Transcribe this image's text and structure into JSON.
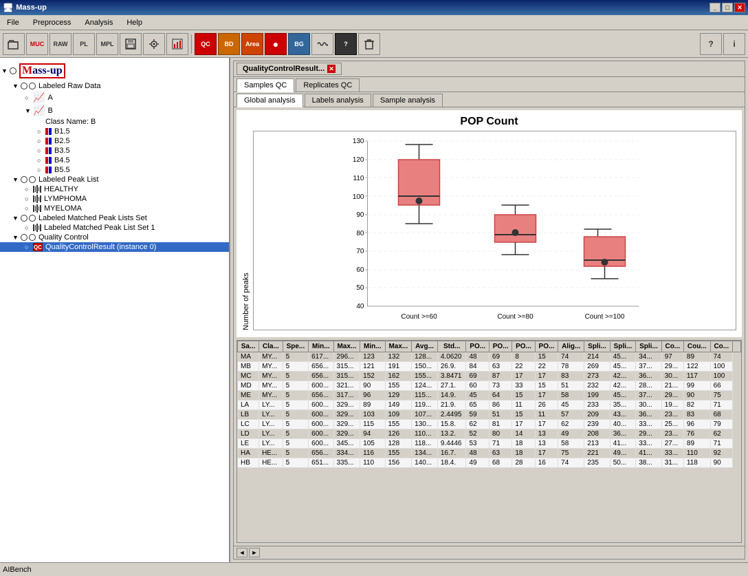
{
  "app": {
    "title": "Mass-up",
    "status_bar": "AIBench"
  },
  "menu": {
    "items": [
      "File",
      "Preprocess",
      "Analysis",
      "Help"
    ]
  },
  "toolbar": {
    "buttons": [
      {
        "name": "open",
        "label": "📂",
        "icon": "open-icon"
      },
      {
        "name": "muc",
        "label": "MUC",
        "icon": "muc-icon"
      },
      {
        "name": "raw",
        "label": "RAW",
        "icon": "raw-icon"
      },
      {
        "name": "pl",
        "label": "PL",
        "icon": "pl-icon"
      },
      {
        "name": "mpl",
        "label": "MPL",
        "icon": "mpl-icon"
      },
      {
        "name": "save",
        "label": "💾",
        "icon": "save-icon"
      },
      {
        "name": "config",
        "label": "⚙",
        "icon": "config-icon"
      },
      {
        "name": "chart",
        "label": "📊",
        "icon": "chart-icon"
      },
      {
        "name": "qc",
        "label": "QC",
        "icon": "qc-icon"
      },
      {
        "name": "bd",
        "label": "BD",
        "icon": "bd-icon"
      },
      {
        "name": "area",
        "label": "Area",
        "icon": "area-icon"
      },
      {
        "name": "red-dot",
        "label": "●",
        "icon": "red-dot-icon"
      },
      {
        "name": "bg",
        "label": "BG",
        "icon": "bg-icon"
      },
      {
        "name": "wave",
        "label": "~",
        "icon": "wave-icon"
      },
      {
        "name": "question2",
        "label": "?",
        "icon": "question2-icon"
      },
      {
        "name": "trash",
        "label": "🗑",
        "icon": "trash-icon"
      }
    ],
    "right_buttons": [
      {
        "name": "help",
        "label": "?",
        "icon": "help-icon"
      },
      {
        "name": "info",
        "label": "i",
        "icon": "info-icon"
      }
    ]
  },
  "tree": {
    "root": "Mass-up",
    "nodes": [
      {
        "id": "labeled-raw-data",
        "label": "Labeled Raw Data",
        "level": 0,
        "type": "folder",
        "expanded": true
      },
      {
        "id": "a",
        "label": "A",
        "level": 1,
        "type": "chart"
      },
      {
        "id": "b",
        "label": "B",
        "level": 1,
        "type": "chart",
        "expanded": true
      },
      {
        "id": "class-b",
        "label": "Class Name: B",
        "level": 2,
        "type": "text"
      },
      {
        "id": "b1.5",
        "label": "B1.5",
        "level": 2,
        "type": "flag"
      },
      {
        "id": "b2.5",
        "label": "B2.5",
        "level": 2,
        "type": "flag"
      },
      {
        "id": "b3.5",
        "label": "B3.5",
        "level": 2,
        "type": "flag"
      },
      {
        "id": "b4.5",
        "label": "B4.5",
        "level": 2,
        "type": "flag"
      },
      {
        "id": "b5.5",
        "label": "B5.5",
        "level": 2,
        "type": "flag"
      },
      {
        "id": "labeled-peak-list",
        "label": "Labeled Peak List",
        "level": 0,
        "type": "folder",
        "expanded": true
      },
      {
        "id": "healthy",
        "label": "HEALTHY",
        "level": 1,
        "type": "barcode"
      },
      {
        "id": "lymphoma",
        "label": "LYMPHOMA",
        "level": 1,
        "type": "barcode"
      },
      {
        "id": "myeloma",
        "label": "MYELOMA",
        "level": 1,
        "type": "barcode"
      },
      {
        "id": "labeled-matched",
        "label": "Labeled Matched Peak Lists Set",
        "level": 0,
        "type": "folder",
        "expanded": true
      },
      {
        "id": "set1",
        "label": "Labeled Matched Peak List Set 1",
        "level": 1,
        "type": "barcode2"
      },
      {
        "id": "quality-control",
        "label": "Quality Control",
        "level": 0,
        "type": "folder",
        "expanded": true
      },
      {
        "id": "qc-result",
        "label": "QualityControlResult (instance 0)",
        "level": 1,
        "type": "qc",
        "selected": true
      }
    ]
  },
  "tab_window": {
    "title": "QualityControlResult...",
    "primary_tabs": [
      "Samples QC",
      "Replicates QC"
    ],
    "active_primary_tab": "Samples QC",
    "secondary_tabs": [
      "Global analysis",
      "Labels analysis",
      "Sample analysis"
    ],
    "active_secondary_tab": "Global analysis"
  },
  "chart": {
    "title": "POP Count",
    "y_axis_label": "Number of peaks",
    "x_labels": [
      "Count >=60",
      "Count >=80",
      "Count >=100"
    ],
    "y_min": 40,
    "y_max": 130,
    "y_ticks": [
      40,
      50,
      60,
      70,
      80,
      90,
      100,
      110,
      120,
      130
    ],
    "box_plots": [
      {
        "label": "Count >=60",
        "x": 100,
        "whisker_low": 85,
        "q1": 95,
        "median": 100,
        "mean": 98,
        "q3": 120,
        "whisker_high": 128,
        "color": "#e88080"
      },
      {
        "label": "Count >=80",
        "x": 240,
        "whisker_low": 68,
        "q1": 75,
        "median": 79,
        "mean": 80,
        "q3": 90,
        "whisker_high": 95,
        "color": "#e88080"
      },
      {
        "label": "Count >=100",
        "x": 370,
        "whisker_low": 55,
        "q1": 62,
        "median": 65,
        "mean": 64,
        "q3": 78,
        "whisker_high": 82,
        "color": "#e88080"
      }
    ]
  },
  "table": {
    "columns": [
      "Sa...",
      "Cla...",
      "Spe...",
      "Min...",
      "Max...",
      "Min...",
      "Max...",
      "Avg...",
      "Std...",
      "PO...",
      "PO...",
      "PO...",
      "PO...",
      "Alig...",
      "Spli...",
      "Spli...",
      "Spli...",
      "Co...",
      "Cou...",
      "Co..."
    ],
    "rows": [
      [
        "MA",
        "MY...",
        "5",
        "617...",
        "296...",
        "123",
        "132",
        "128...",
        "4.0620",
        "48",
        "69",
        "8",
        "15",
        "74",
        "214",
        "45...",
        "34...",
        "97",
        "89",
        "74"
      ],
      [
        "MB",
        "MY...",
        "5",
        "656...",
        "315...",
        "121",
        "191",
        "150...",
        "26.9.",
        "84",
        "63",
        "22",
        "22",
        "78",
        "269",
        "45...",
        "37...",
        "29...",
        "122",
        "100"
      ],
      [
        "MC",
        "MY...",
        "5",
        "656...",
        "315...",
        "152",
        "162",
        "155...",
        "3.8471",
        "69",
        "87",
        "17",
        "17",
        "83",
        "273",
        "42...",
        "36...",
        "30...",
        "117",
        "100"
      ],
      [
        "MD",
        "MY...",
        "5",
        "600...",
        "321...",
        "90",
        "155",
        "124...",
        "27.1.",
        "60",
        "73",
        "33",
        "15",
        "51",
        "232",
        "42...",
        "28...",
        "21...",
        "99",
        "66"
      ],
      [
        "ME",
        "MY...",
        "5",
        "656...",
        "317...",
        "96",
        "129",
        "115...",
        "14.9.",
        "45",
        "64",
        "15",
        "17",
        "58",
        "199",
        "45...",
        "37...",
        "29...",
        "90",
        "75"
      ],
      [
        "LA",
        "LY...",
        "5",
        "600...",
        "329...",
        "89",
        "149",
        "119...",
        "21.9.",
        "65",
        "86",
        "11",
        "26",
        "45",
        "233",
        "35...",
        "30...",
        "19...",
        "82",
        "71"
      ],
      [
        "LB",
        "LY...",
        "5",
        "600...",
        "329...",
        "103",
        "109",
        "107...",
        "2.4495",
        "59",
        "51",
        "15",
        "11",
        "57",
        "209",
        "43...",
        "36...",
        "23...",
        "83",
        "68"
      ],
      [
        "LC",
        "LY...",
        "5",
        "600...",
        "329...",
        "115",
        "155",
        "130...",
        "15.8.",
        "62",
        "81",
        "17",
        "17",
        "62",
        "239",
        "40...",
        "33...",
        "25...",
        "96",
        "79"
      ],
      [
        "LD",
        "LY...",
        "5",
        "600...",
        "329...",
        "94",
        "126",
        "110...",
        "13.2.",
        "52",
        "80",
        "14",
        "13",
        "49",
        "208",
        "36...",
        "29...",
        "23...",
        "76",
        "62"
      ],
      [
        "LE",
        "LY...",
        "5",
        "600...",
        "345...",
        "105",
        "128",
        "118...",
        "9.4446",
        "53",
        "71",
        "18",
        "13",
        "58",
        "213",
        "41...",
        "33...",
        "27...",
        "89",
        "71"
      ],
      [
        "HA",
        "HE...",
        "5",
        "656...",
        "334...",
        "116",
        "155",
        "134...",
        "16.7.",
        "48",
        "63",
        "18",
        "17",
        "75",
        "221",
        "49...",
        "41...",
        "33...",
        "110",
        "92"
      ],
      [
        "HB",
        "HE...",
        "5",
        "651...",
        "335...",
        "110",
        "156",
        "140...",
        "18.4.",
        "49",
        "68",
        "28",
        "16",
        "74",
        "235",
        "50...",
        "38...",
        "31...",
        "118",
        "90"
      ]
    ]
  }
}
